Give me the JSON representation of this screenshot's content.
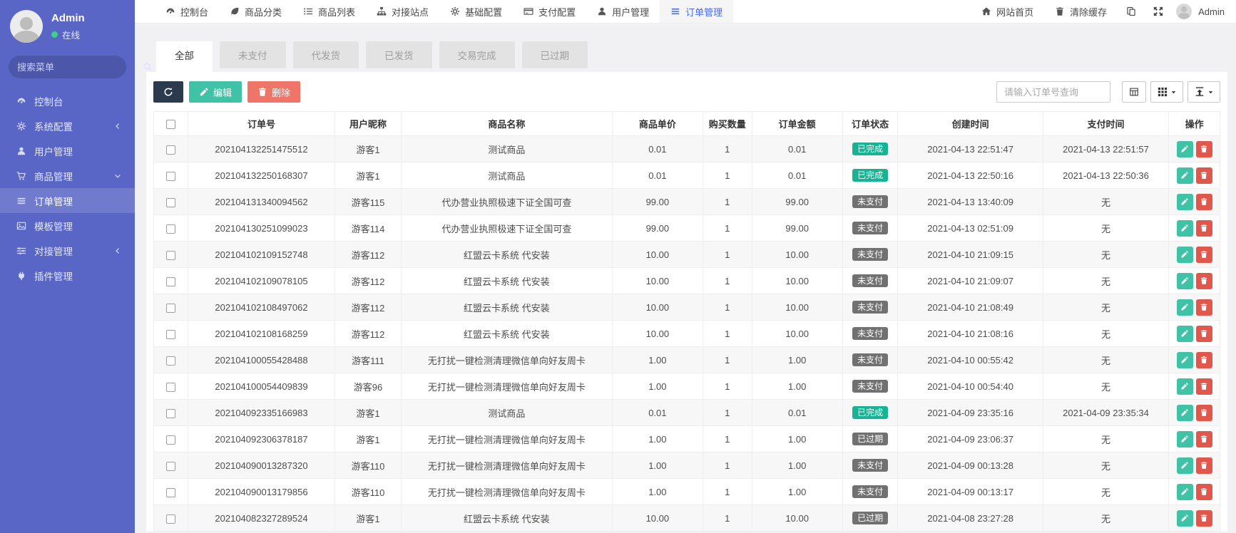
{
  "colors": {
    "sidebar_bg": "#5966c5",
    "accent_blue": "#4d6bdf",
    "green": "#3fc2a5",
    "dark_navy": "#2b3a4d",
    "red_soft": "#ee7568",
    "red": "#e2574b",
    "badge_done": "#18b294",
    "badge_gray": "#717171",
    "online_green": "#3fd08f"
  },
  "sidebar": {
    "user": {
      "name": "Admin",
      "status": "在线"
    },
    "search_placeholder": "搜索菜单",
    "items": [
      {
        "label": "控制台",
        "icon": "dashboard-icon"
      },
      {
        "label": "系统配置",
        "icon": "gear-icon",
        "chevron": "left"
      },
      {
        "label": "用户管理",
        "icon": "user-icon"
      },
      {
        "label": "商品管理",
        "icon": "cart-icon",
        "chevron": "down"
      },
      {
        "label": "订单管理",
        "icon": "order-list-icon",
        "active": true
      },
      {
        "label": "模板管理",
        "icon": "template-icon"
      },
      {
        "label": "对接管理",
        "icon": "sliders-icon",
        "chevron": "left"
      },
      {
        "label": "插件管理",
        "icon": "plugin-icon"
      }
    ]
  },
  "topnav": {
    "menu": [
      {
        "label": "控制台",
        "icon": "dashboard-icon"
      },
      {
        "label": "商品分类",
        "icon": "leaf-icon"
      },
      {
        "label": "商品列表",
        "icon": "list-icon"
      },
      {
        "label": "对接站点",
        "icon": "sitemap-icon"
      },
      {
        "label": "基础配置",
        "icon": "gear-icon"
      },
      {
        "label": "支付配置",
        "icon": "credit-card-icon"
      },
      {
        "label": "用户管理",
        "icon": "user-icon"
      },
      {
        "label": "订单管理",
        "icon": "order-list-icon",
        "active": true
      }
    ],
    "right_links": [
      {
        "label": "网站首页",
        "icon": "home-icon"
      },
      {
        "label": "清除缓存",
        "icon": "trash-icon"
      }
    ],
    "right_icons": [
      "copy-icon",
      "expand-icon"
    ],
    "user": "Admin"
  },
  "tabs": [
    {
      "label": "全部",
      "active": true
    },
    {
      "label": "未支付"
    },
    {
      "label": "代发货"
    },
    {
      "label": "已发货"
    },
    {
      "label": "交易完成"
    },
    {
      "label": "已过期"
    }
  ],
  "toolbar": {
    "edit_label": "编辑",
    "delete_label": "删除",
    "search_placeholder": "请输入订单号查询"
  },
  "table": {
    "headers": [
      "订单号",
      "用户昵称",
      "商品名称",
      "商品单价",
      "购买数量",
      "订单金额",
      "订单状态",
      "创建时间",
      "支付时间",
      "操作"
    ],
    "rows": [
      {
        "no": "202104132251475512",
        "nick": "游客1",
        "product": "测试商品",
        "price": "0.01",
        "qty": "1",
        "amount": "0.01",
        "status": "已完成",
        "status_type": "done",
        "created": "2021-04-13 22:51:47",
        "paid": "2021-04-13 22:51:57"
      },
      {
        "no": "202104132250168307",
        "nick": "游客1",
        "product": "测试商品",
        "price": "0.01",
        "qty": "1",
        "amount": "0.01",
        "status": "已完成",
        "status_type": "done",
        "created": "2021-04-13 22:50:16",
        "paid": "2021-04-13 22:50:36"
      },
      {
        "no": "202104131340094562",
        "nick": "游客115",
        "product": "代办营业执照极速下证全国可查",
        "price": "99.00",
        "qty": "1",
        "amount": "99.00",
        "status": "未支付",
        "status_type": "pending",
        "created": "2021-04-13 13:40:09",
        "paid": "无"
      },
      {
        "no": "202104130251099023",
        "nick": "游客114",
        "product": "代办营业执照极速下证全国可查",
        "price": "99.00",
        "qty": "1",
        "amount": "99.00",
        "status": "未支付",
        "status_type": "pending",
        "created": "2021-04-13 02:51:09",
        "paid": "无"
      },
      {
        "no": "202104102109152748",
        "nick": "游客112",
        "product": "红盟云卡系统 代安装",
        "price": "10.00",
        "qty": "1",
        "amount": "10.00",
        "status": "未支付",
        "status_type": "pending",
        "created": "2021-04-10 21:09:15",
        "paid": "无"
      },
      {
        "no": "202104102109078105",
        "nick": "游客112",
        "product": "红盟云卡系统 代安装",
        "price": "10.00",
        "qty": "1",
        "amount": "10.00",
        "status": "未支付",
        "status_type": "pending",
        "created": "2021-04-10 21:09:07",
        "paid": "无"
      },
      {
        "no": "202104102108497062",
        "nick": "游客112",
        "product": "红盟云卡系统 代安装",
        "price": "10.00",
        "qty": "1",
        "amount": "10.00",
        "status": "未支付",
        "status_type": "pending",
        "created": "2021-04-10 21:08:49",
        "paid": "无"
      },
      {
        "no": "202104102108168259",
        "nick": "游客112",
        "product": "红盟云卡系统 代安装",
        "price": "10.00",
        "qty": "1",
        "amount": "10.00",
        "status": "未支付",
        "status_type": "pending",
        "created": "2021-04-10 21:08:16",
        "paid": "无"
      },
      {
        "no": "202104100055428488",
        "nick": "游客111",
        "product": "无打扰一键检测清理微信单向好友周卡",
        "price": "1.00",
        "qty": "1",
        "amount": "1.00",
        "status": "未支付",
        "status_type": "pending",
        "created": "2021-04-10 00:55:42",
        "paid": "无"
      },
      {
        "no": "202104100054409839",
        "nick": "游客96",
        "product": "无打扰一键检测清理微信单向好友周卡",
        "price": "1.00",
        "qty": "1",
        "amount": "1.00",
        "status": "未支付",
        "status_type": "pending",
        "created": "2021-04-10 00:54:40",
        "paid": "无"
      },
      {
        "no": "202104092335166983",
        "nick": "游客1",
        "product": "测试商品",
        "price": "0.01",
        "qty": "1",
        "amount": "0.01",
        "status": "已完成",
        "status_type": "done",
        "created": "2021-04-09 23:35:16",
        "paid": "2021-04-09 23:35:34"
      },
      {
        "no": "202104092306378187",
        "nick": "游客1",
        "product": "无打扰一键检测清理微信单向好友周卡",
        "price": "1.00",
        "qty": "1",
        "amount": "1.00",
        "status": "已过期",
        "status_type": "expired",
        "created": "2021-04-09 23:06:37",
        "paid": "无"
      },
      {
        "no": "202104090013287320",
        "nick": "游客110",
        "product": "无打扰一键检测清理微信单向好友周卡",
        "price": "1.00",
        "qty": "1",
        "amount": "1.00",
        "status": "未支付",
        "status_type": "pending",
        "created": "2021-04-09 00:13:28",
        "paid": "无"
      },
      {
        "no": "202104090013179856",
        "nick": "游客110",
        "product": "无打扰一键检测清理微信单向好友周卡",
        "price": "1.00",
        "qty": "1",
        "amount": "1.00",
        "status": "未支付",
        "status_type": "pending",
        "created": "2021-04-09 00:13:17",
        "paid": "无"
      },
      {
        "no": "202104082327289524",
        "nick": "游客1",
        "product": "红盟云卡系统 代安装",
        "price": "10.00",
        "qty": "1",
        "amount": "10.00",
        "status": "已过期",
        "status_type": "expired",
        "created": "2021-04-08 23:27:28",
        "paid": "无"
      }
    ]
  }
}
